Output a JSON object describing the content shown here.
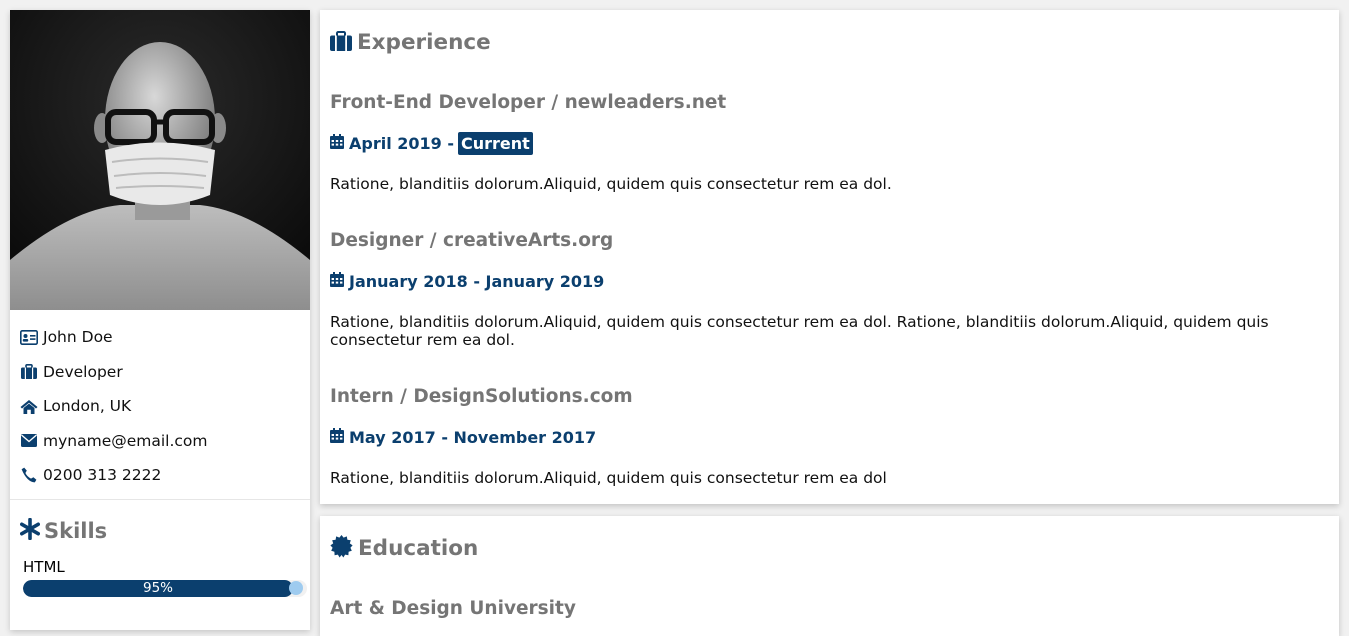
{
  "profile": {
    "name": "John Doe",
    "role": "Developer",
    "location": "London, UK",
    "email": "myname@email.com",
    "phone": "0200 313 2222"
  },
  "skills": {
    "title": "Skills",
    "items": [
      {
        "label": "HTML",
        "percent_text": "95%",
        "percent": 95
      }
    ]
  },
  "experience": {
    "title": "Experience",
    "jobs": [
      {
        "title": "Front-End Developer / newleaders.net",
        "date_start": "April 2019 -",
        "date_current": "Current",
        "description": "Ratione, blanditiis dolorum.Aliquid, quidem quis consectetur rem ea dol."
      },
      {
        "title": "Designer / creativeArts.org",
        "date": "January 2018 - January 2019",
        "description": "Ratione, blanditiis dolorum.Aliquid, quidem quis consectetur rem ea dol. Ratione, blanditiis dolorum.Aliquid, quidem quis consectetur rem ea dol."
      },
      {
        "title": "Intern / DesignSolutions.com",
        "date": "May 2017 - November 2017",
        "description": "Ratione, blanditiis dolorum.Aliquid, quidem quis consectetur rem ea dol"
      }
    ]
  },
  "education": {
    "title": "Education",
    "first_item": "Art & Design University"
  },
  "colors": {
    "accent": "#0b3f6e",
    "heading_gray": "#757575",
    "background": "#f1f1f1"
  },
  "icons": [
    "id-card-icon",
    "briefcase-icon",
    "home-icon",
    "envelope-icon",
    "phone-icon",
    "asterisk-icon",
    "calendar-icon",
    "certificate-icon"
  ]
}
